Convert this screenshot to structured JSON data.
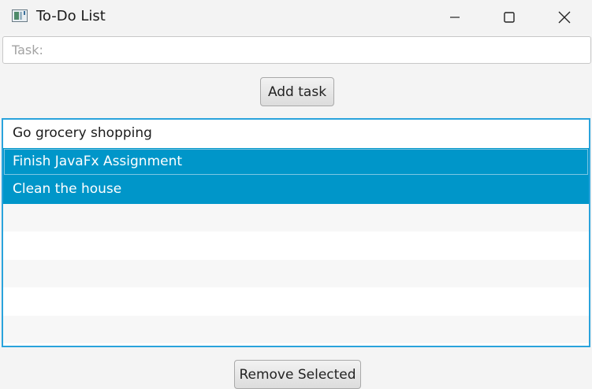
{
  "window": {
    "title": "To-Do List",
    "controls": [
      "minimize-icon",
      "maximize-icon",
      "close-icon"
    ]
  },
  "task_input": {
    "placeholder": "Task:",
    "value": ""
  },
  "add_button": {
    "label": "Add task"
  },
  "task_list": {
    "items": [
      {
        "label": "Go grocery shopping",
        "selected": false
      },
      {
        "label": "Finish JavaFx Assignment",
        "selected": true
      },
      {
        "label": "Clean the house",
        "selected": true
      }
    ],
    "empty_rows": 5
  },
  "remove_button": {
    "label": "Remove Selected"
  },
  "colors": {
    "selection": "#0096c9",
    "focus_border": "#2aa3dc"
  }
}
